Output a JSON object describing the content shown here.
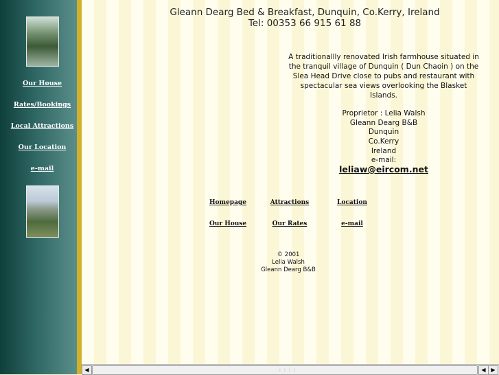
{
  "sidebar": {
    "links": [
      {
        "label": "Our House"
      },
      {
        "label": "Rates/Bookings"
      },
      {
        "label": "Local Attractions"
      },
      {
        "label": "Our Location"
      },
      {
        "label": "e-mail"
      }
    ]
  },
  "header": {
    "title": "Gleann Dearg Bed & Breakfast, Dunquin, Co.Kerry, Ireland",
    "phone": "Tel: 00353 66 915 61 88"
  },
  "description": "A traditionallly renovated Irish farmhouse situated in the tranquil village of Dunquin ( Dun Chaoin ) on the Slea Head Drive close to pubs and restaurant with spectacular sea views overlooking the Blasket Islands.",
  "contact": {
    "lines": [
      "Proprietor : Lelia Walsh",
      "Gleann Dearg B&B",
      "Dunquin",
      "Co.Kerry",
      "Ireland",
      "e-mail:"
    ],
    "email": "leliaw@eircom.net"
  },
  "nav": {
    "row1": [
      "Homepage",
      "Attractions",
      "Location"
    ],
    "row2": [
      "Our House",
      "Our Rates",
      "e-mail"
    ]
  },
  "footer": {
    "lines": [
      "© 2001",
      "Lelia Walsh",
      "Gleann Dearg B&B"
    ]
  },
  "scrollbar": {
    "left_arrow": "◀",
    "right_arrow_1": "◀",
    "right_arrow_2": "▶"
  }
}
